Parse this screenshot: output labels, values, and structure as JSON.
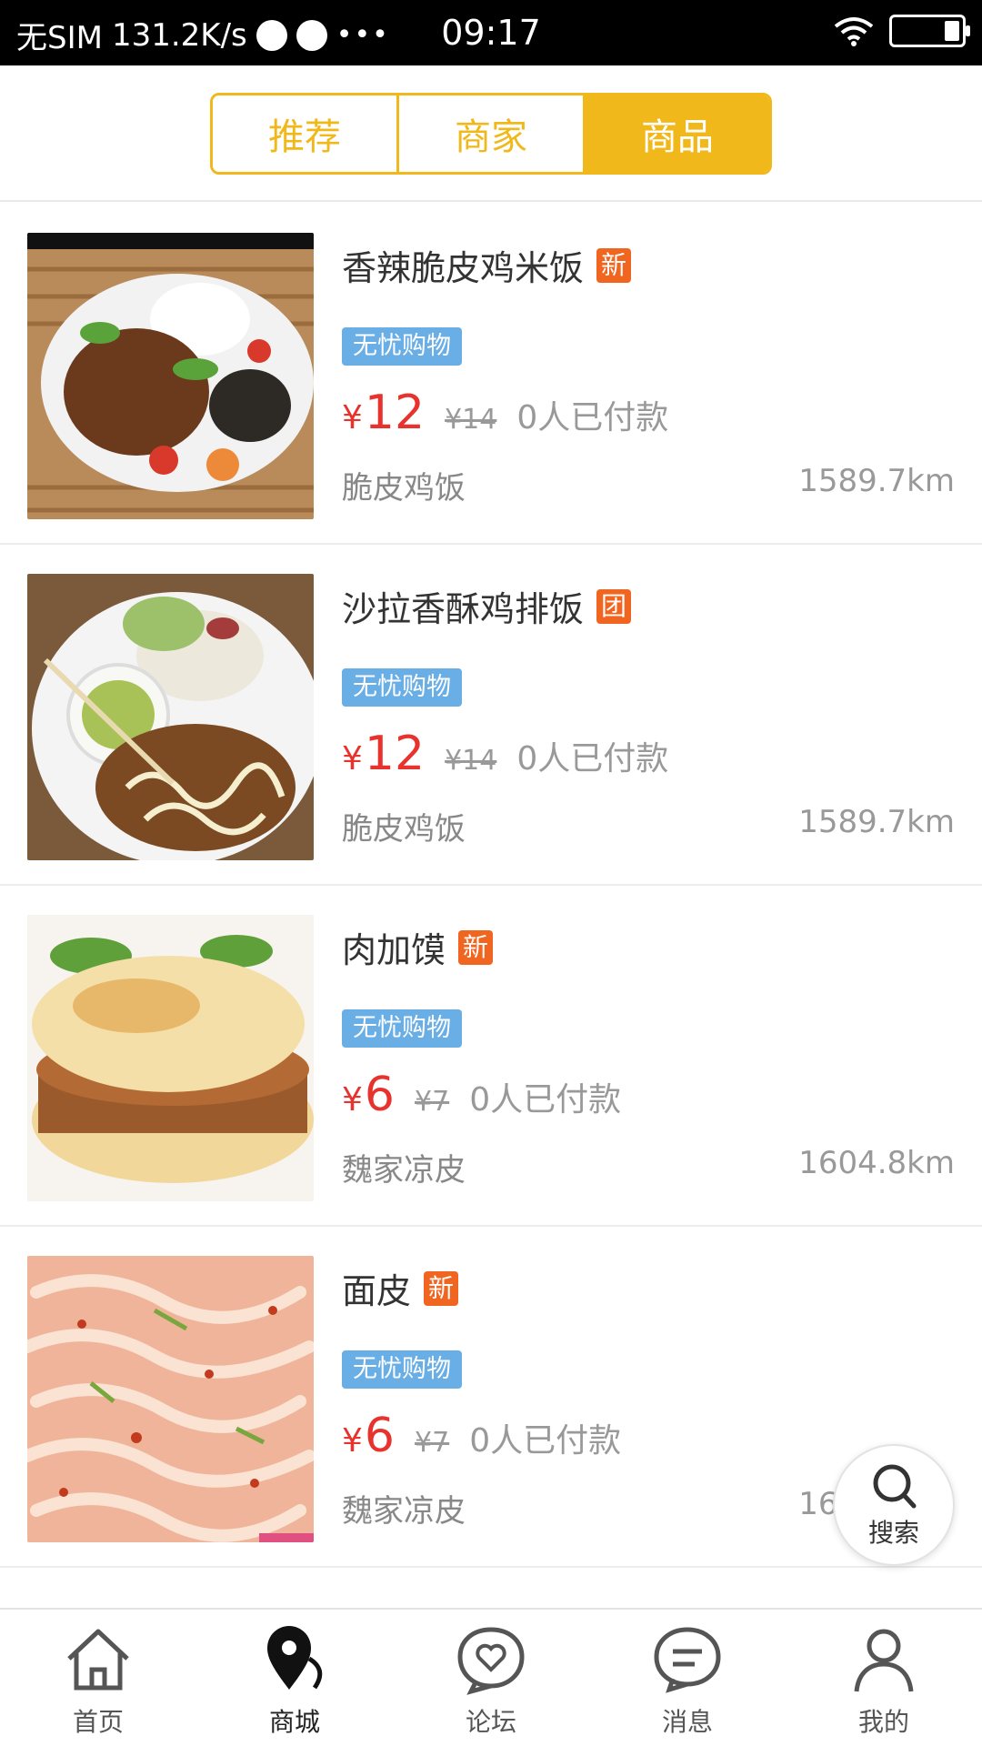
{
  "status_bar": {
    "carrier": "无SIM",
    "speed": "131.2K/s",
    "dots": "•••",
    "time": "09:17"
  },
  "segment": {
    "tabs": [
      {
        "label": "推荐",
        "active": false
      },
      {
        "label": "商家",
        "active": false
      },
      {
        "label": "商品",
        "active": true
      }
    ]
  },
  "products": [
    {
      "title": "香辣脆皮鸡米饭",
      "tag": "新",
      "service": "无忧购物",
      "currency": "¥",
      "price": "12",
      "original_price": "¥14",
      "paid": "0人已付款",
      "shop": "脆皮鸡饭",
      "distance": "1589.7km"
    },
    {
      "title": "沙拉香酥鸡排饭",
      "tag": "团",
      "service": "无忧购物",
      "currency": "¥",
      "price": "12",
      "original_price": "¥14",
      "paid": "0人已付款",
      "shop": "脆皮鸡饭",
      "distance": "1589.7km"
    },
    {
      "title": "肉加馍",
      "tag": "新",
      "service": "无忧购物",
      "currency": "¥",
      "price": "6",
      "original_price": "¥7",
      "paid": "0人已付款",
      "shop": "魏家凉皮",
      "distance": "1604.8km"
    },
    {
      "title": "面皮",
      "tag": "新",
      "service": "无忧购物",
      "currency": "¥",
      "price": "6",
      "original_price": "¥7",
      "paid": "0人已付款",
      "shop": "魏家凉皮",
      "distance": "1604.8km"
    }
  ],
  "fab": {
    "label": "搜索"
  },
  "bottom_nav": [
    {
      "label": "首页",
      "icon": "home-icon"
    },
    {
      "label": "商城",
      "icon": "map-pin-icon"
    },
    {
      "label": "论坛",
      "icon": "heart-chat-icon"
    },
    {
      "label": "消息",
      "icon": "message-icon"
    },
    {
      "label": "我的",
      "icon": "user-icon"
    }
  ],
  "colors": {
    "accent": "#f0b81a",
    "price": "#e8322d",
    "badge_new": "#f0651f",
    "service": "#6aaee6"
  }
}
